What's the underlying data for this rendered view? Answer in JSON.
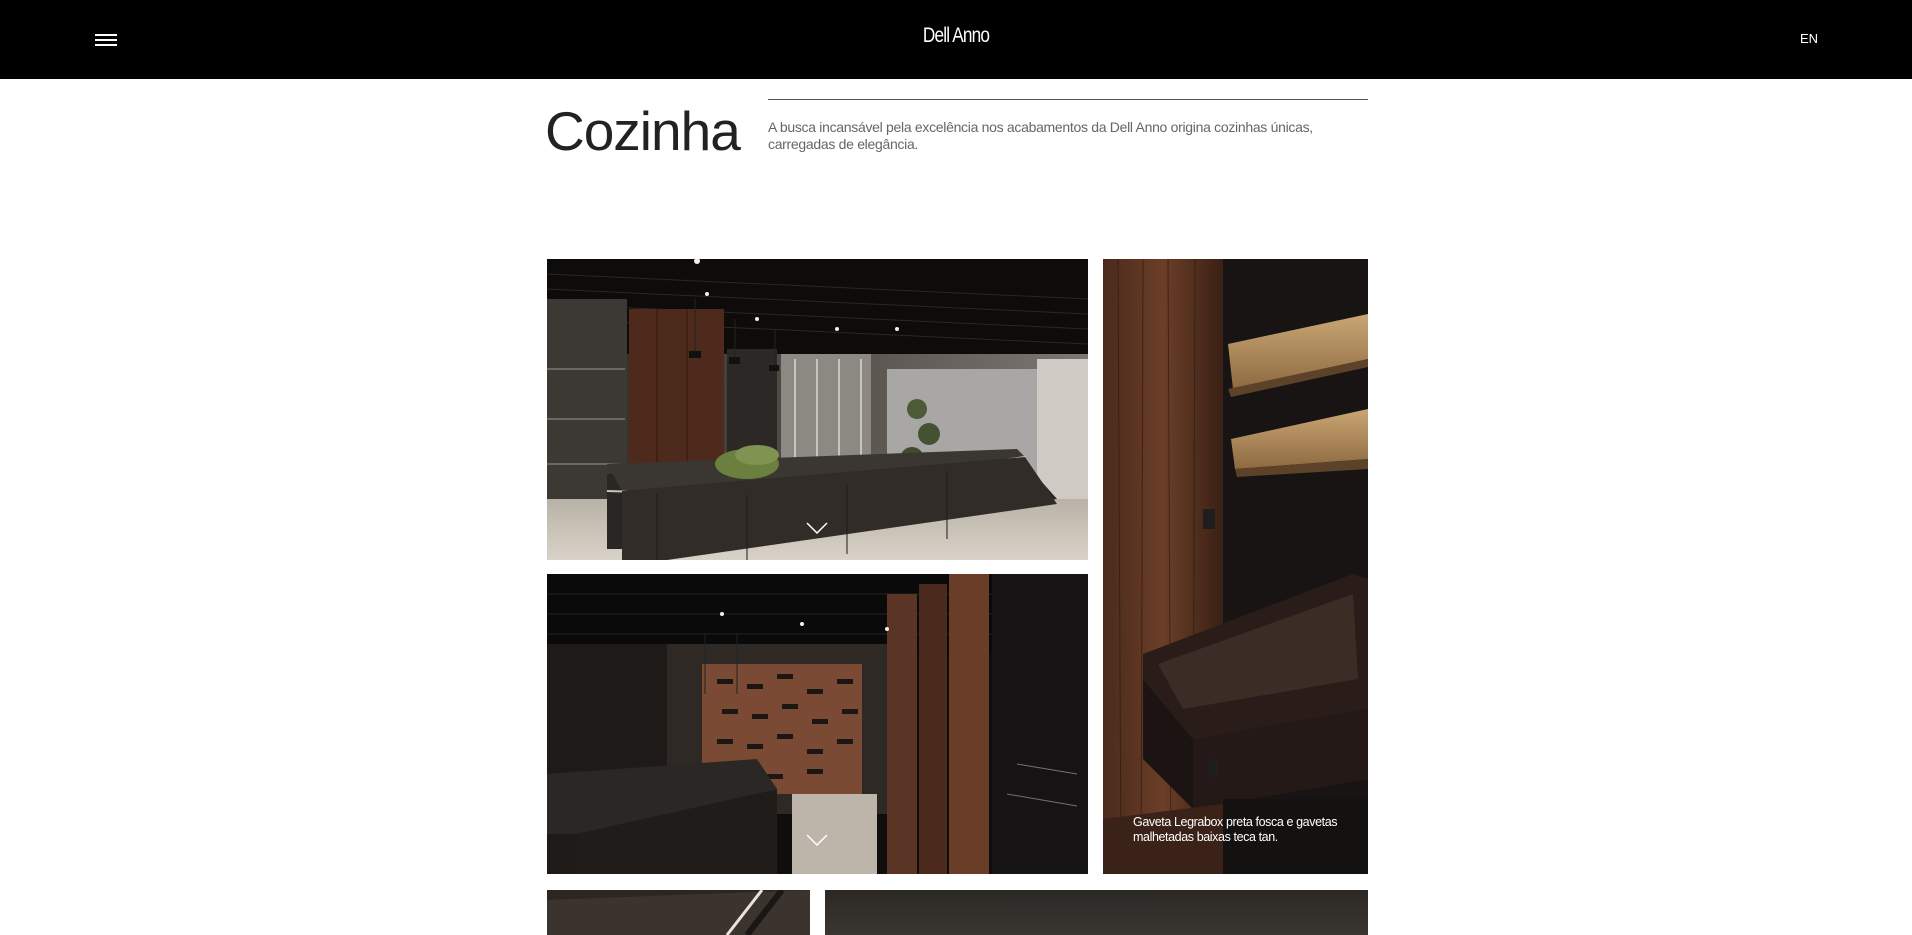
{
  "header": {
    "logo": "Dell Anno",
    "language": "EN",
    "menu_icon": "hamburger-menu-icon"
  },
  "hero": {
    "title": "Cozinha",
    "description": "A busca incansável pela excelência nos acabamentos da Dell Anno origina cozinhas únicas, carregadas de elegância."
  },
  "gallery": {
    "tiles": [
      {
        "kind": "photo",
        "subject": "kitchen island with walnut cabinetry",
        "icon": "chevron-down-icon"
      },
      {
        "kind": "photo",
        "subject": "wine cellar wall and dark kitchen",
        "icon": "chevron-down-icon"
      },
      {
        "kind": "photo",
        "subject": "drawer detail",
        "caption": "Gaveta Legrabox preta fosca e gavetas malhetadas baixas teca tan."
      },
      {
        "kind": "photo",
        "subject": "partial bottom-left tile"
      },
      {
        "kind": "photo",
        "subject": "partial bottom-right tile"
      }
    ]
  },
  "colors": {
    "header_bg": "#000000",
    "text_dark": "#222222",
    "text_muted": "#666666",
    "walnut": "#5a3424",
    "teak": "#b48a56"
  }
}
